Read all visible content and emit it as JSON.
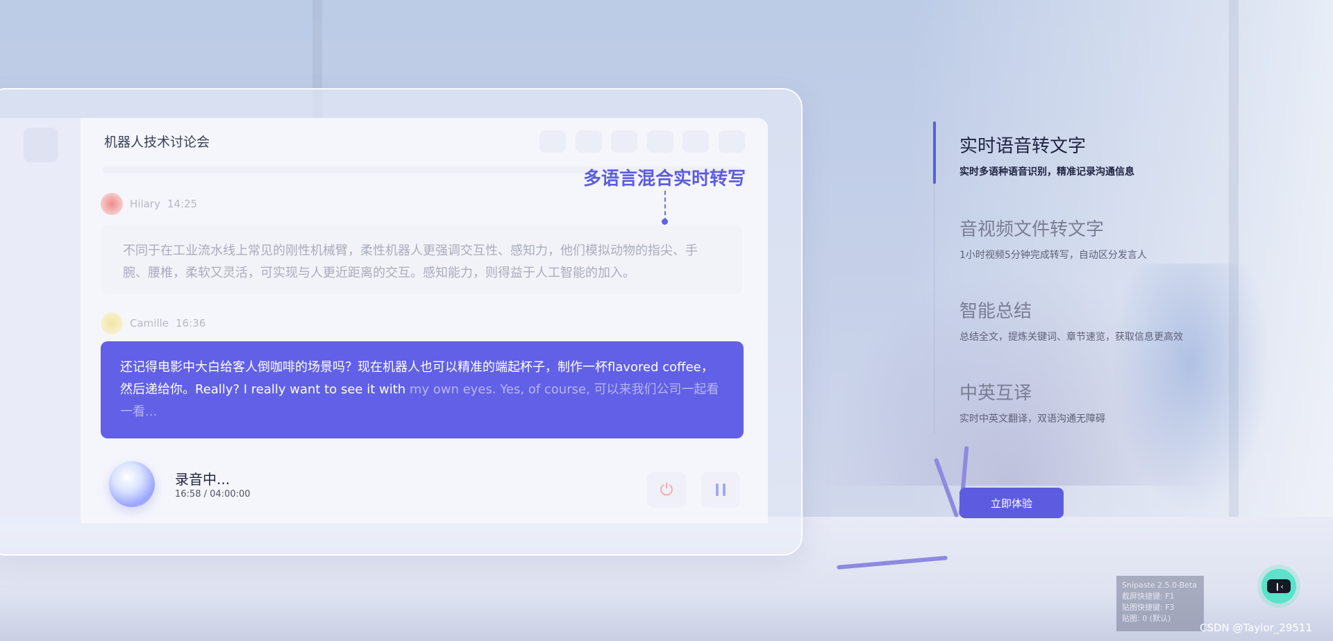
{
  "app": {
    "title": "机器人技术讨论会"
  },
  "messages": [
    {
      "author": "Hilary",
      "time": "14:25",
      "text": "不同于在工业流水线上常见的刚性机械臂，柔性机器人更强调交互性、感知力，他们模拟动物的指尖、手腕、腰椎，柔软又灵活，可实现与人更近距离的交互。感知能力，则得益于人工智能的加入。"
    },
    {
      "author": "Camille",
      "time": "16:36",
      "text": "还记得电影中大白给客人倒咖啡的场景吗？现在机器人也可以精准的端起杯子，制作一杯flavored coffee，然后递给你。Really? I really want to see it with ",
      "text_dim": "my own eyes. Yes, of course, 可以来我们公司一起看一看..."
    }
  ],
  "callout": "多语言混合实时转写",
  "recording": {
    "status": "录音中...",
    "elapsed": "16:58",
    "separator": "/",
    "total": "04:00:00"
  },
  "features": [
    {
      "title": "实时语音转文字",
      "desc": "实时多语种语音识别，精准记录沟通信息",
      "active": true
    },
    {
      "title": "音视频文件转文字",
      "desc": "1小时视频5分钟完成转写，自动区分发言人"
    },
    {
      "title": "智能总结",
      "desc": "总结全文，提炼关键词、章节速览，获取信息更高效"
    },
    {
      "title": "中英互译",
      "desc": "实时中英文翻译，双语沟通无障碍"
    }
  ],
  "cta_label": "立即体验",
  "snipaste": {
    "line1": "Snipaste 2.5.0-Beta",
    "line2": "截屏快捷键: F1",
    "line3": "贴图快捷键: F3",
    "line4": "贴图: 0 (默认)"
  },
  "watermark": "CSDN @Taylor_29511",
  "colors": {
    "accent": "#6160e6",
    "float": "#5be3c9"
  }
}
